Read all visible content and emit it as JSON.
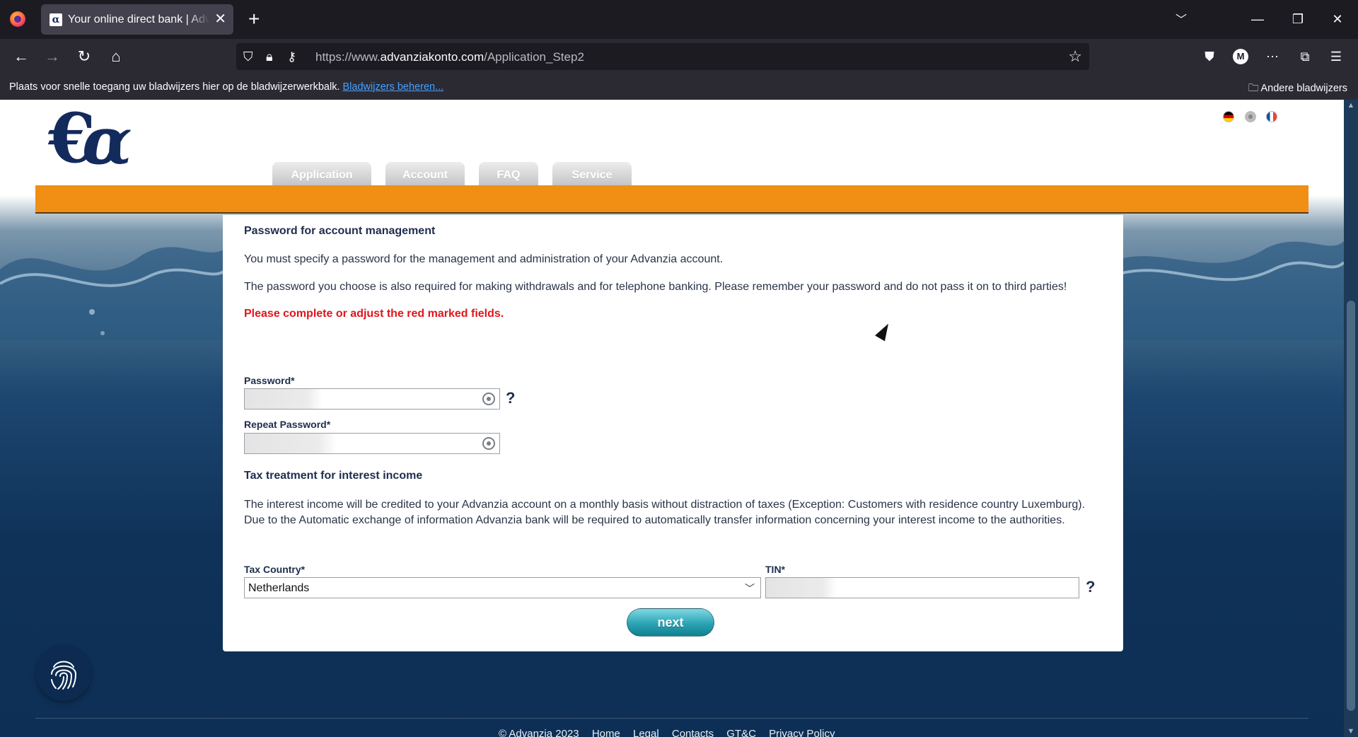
{
  "browser": {
    "tab_title": "Your online direct bank | Advanzia",
    "url_scheme": "https://www.",
    "url_host": "advanziakonto.com",
    "url_path": "/Application_Step2",
    "bookmarks_text": "Plaats voor snelle toegang uw bladwijzers hier op de bladwijzerwerkbalk.",
    "bookmarks_link": "Bladwijzers beheren...",
    "other_bookmarks": "Andere bladwijzers",
    "profile_initial": "M"
  },
  "site": {
    "tabs": [
      "Application",
      "Account",
      "FAQ",
      "Service"
    ],
    "colors": {
      "orange": "#f08f14",
      "navy": "#1e2d4d",
      "error": "#e0151b",
      "button": "#2aa3b4"
    }
  },
  "form": {
    "password_heading": "Password for account management",
    "para1": "You must specify a password for the management and administration of your Advanzia account.",
    "para2": "The password you choose is also required for making withdrawals and for telephone banking. Please remember your password and do not pass it on to third parties!",
    "error_msg": "Please complete or adjust the red marked fields.",
    "password_label": "Password*",
    "repeat_label": "Repeat Password*",
    "help": "?",
    "tax_heading": "Tax treatment for interest income",
    "tax_para": "The interest income will be credited to your Advanzia account on a monthly basis without distraction of taxes (Exception: Customers with residence country Luxemburg). Due to the Automatic exchange of information Advanzia bank will be required to automatically transfer information concerning your interest income to the authorities.",
    "tax_country_label": "Tax Country*",
    "tax_country_value": "Netherlands",
    "tin_label": "TIN*",
    "next_label": "next"
  },
  "footer": {
    "copyright": "© Advanzia 2023",
    "links": [
      "Home",
      "Legal",
      "Contacts",
      "GT&C",
      "Privacy Policy"
    ]
  }
}
